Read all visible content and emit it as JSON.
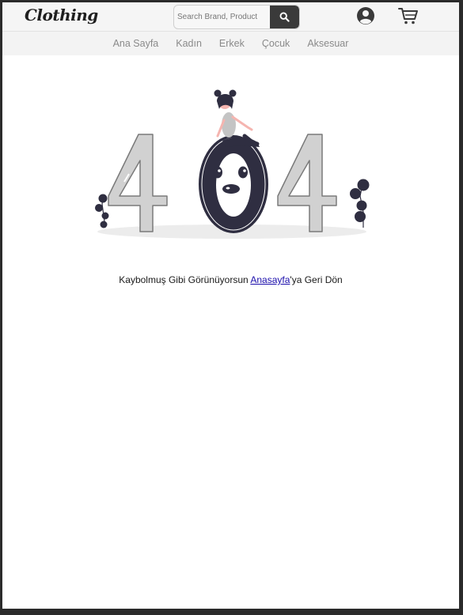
{
  "header": {
    "logo_text": "Clothing",
    "search_placeholder": "Search Brand, Product",
    "search_icon": "search-icon",
    "user_icon": "user-icon",
    "cart_icon": "cart-icon"
  },
  "nav": {
    "items": [
      "Ana Sayfa",
      "Kadın",
      "Erkek",
      "Çocuk",
      "Aksesuar"
    ]
  },
  "error": {
    "code_graphic": "404",
    "message_before": "Kaybolmuş Gibi Görünüyorsun ",
    "link_text": "Anasayfa",
    "message_after": "'ya Geri Dön"
  },
  "colors": {
    "dark": "#3a3a3a",
    "navy": "#2f2e41",
    "gray": "#c9c9c9",
    "link": "#1a0dab"
  }
}
